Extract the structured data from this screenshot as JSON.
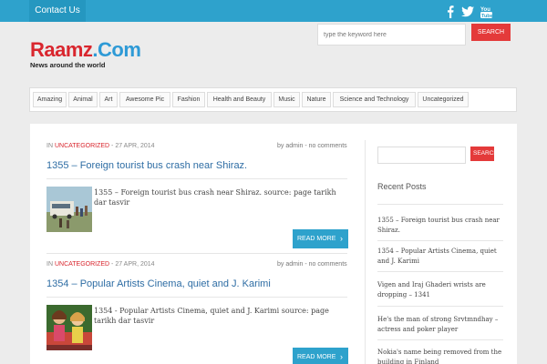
{
  "topbar": {
    "contact": "Contact Us",
    "social_icons": [
      "facebook-icon",
      "twitter-icon",
      "youtube-icon"
    ],
    "color": "#2ea2cc"
  },
  "header": {
    "logo_part1": "Raamz",
    "logo_part2": ".Com",
    "tagline": "News around the world",
    "search_placeholder": "type the keyword here",
    "search_button": "SEARCH"
  },
  "nav": {
    "items": [
      {
        "label": "Amazing"
      },
      {
        "label": "Animal"
      },
      {
        "label": "Art"
      },
      {
        "label": "Awesome Pic"
      },
      {
        "label": "Fashion"
      },
      {
        "label": "Health and Beauty"
      },
      {
        "label": "Music"
      },
      {
        "label": "Nature"
      },
      {
        "label": "Science and Technology"
      },
      {
        "label": "Uncategorized"
      }
    ]
  },
  "posts": [
    {
      "meta_in": "IN ",
      "category": "UNCATEGORIZED",
      "date": " - 27 APR, 2014",
      "byline": "by admin - no comments",
      "title": "1355 – Foreign tourist bus crash near Shiraz.",
      "excerpt": "1355 – Foreign tourist bus crash near Shiraz. source: page tarikh dar tasvir",
      "read_more": "READ MORE"
    },
    {
      "meta_in": "IN ",
      "category": "UNCATEGORIZED",
      "date": " - 27 APR, 2014",
      "byline": "by admin - no comments",
      "title": "1354 – Popular Artists Cinema, quiet and J. Karimi",
      "excerpt": "1354 - Popular Artists Cinema, quiet and J. Karimi source: page tarikh dar tasvir",
      "read_more": "READ MORE"
    }
  ],
  "sidebar": {
    "search_button": "SEARCH",
    "recent_heading": "Recent Posts",
    "recent": [
      "1355 – Foreign tourist bus crash near Shiraz.",
      "1354 – Popular Artists Cinema, quiet and J. Karimi",
      "Vigen and Iraj Ghaderi wrists are dropping – 1341",
      "He's the man of strong Srvtmndhay – actress and poker player",
      "Nokia's name being removed from the building in Finland"
    ]
  },
  "colors": {
    "accent_blue": "#2ea2cc",
    "accent_red": "#d9262e",
    "link_blue": "#2e6da4"
  }
}
